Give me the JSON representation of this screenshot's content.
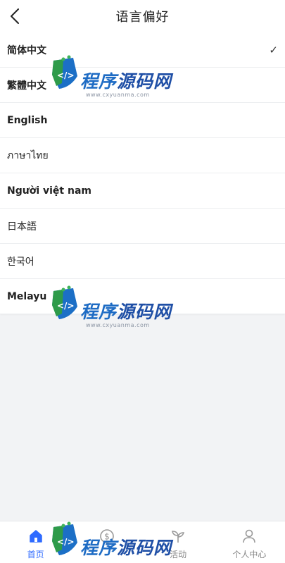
{
  "header": {
    "title": "语言偏好",
    "back_icon": "chevron-left-icon"
  },
  "languages": [
    {
      "label": "简体中文",
      "bold": true,
      "selected": true
    },
    {
      "label": "繁體中文",
      "bold": true,
      "selected": false
    },
    {
      "label": "English",
      "bold": true,
      "selected": false
    },
    {
      "label": "ภาษาไทย",
      "bold": false,
      "selected": false
    },
    {
      "label": "Người việt nam",
      "bold": true,
      "selected": false
    },
    {
      "label": "日本語",
      "bold": false,
      "selected": false
    },
    {
      "label": "한국어",
      "bold": false,
      "selected": false
    },
    {
      "label": "Melayu",
      "bold": true,
      "selected": false
    }
  ],
  "check_mark": "✓",
  "watermark": {
    "text_a": "程序",
    "text_b": "源码网",
    "url": "www.cxyuanma.com"
  },
  "tabbar": {
    "tabs": [
      {
        "label": "首页",
        "icon": "home-icon",
        "active": true
      },
      {
        "label": "",
        "icon": "coin-icon",
        "active": false
      },
      {
        "label": "活动",
        "icon": "sprout-icon",
        "active": false
      },
      {
        "label": "个人中心",
        "icon": "person-icon",
        "active": false
      }
    ]
  },
  "colors": {
    "accent": "#2f6bff",
    "background": "#f2f3f5"
  }
}
